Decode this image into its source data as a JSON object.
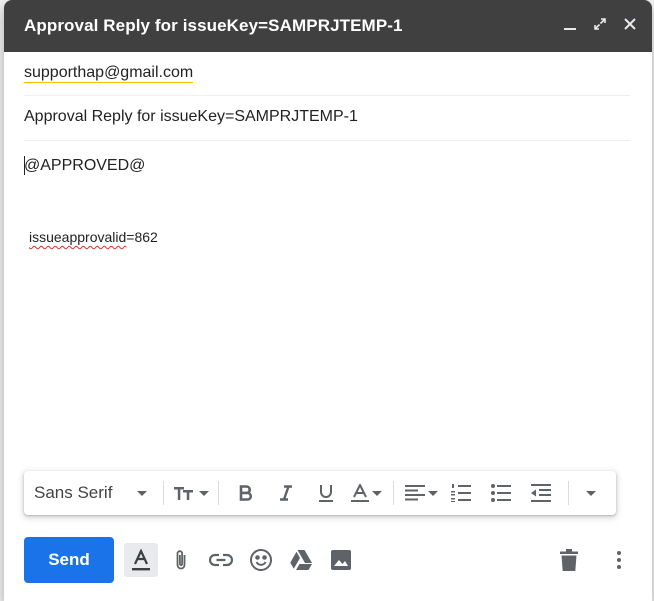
{
  "window": {
    "title": "Approval Reply for issueKey=SAMPRJTEMP-1"
  },
  "recipients": {
    "to": "supporthap@gmail.com"
  },
  "subject": {
    "value": "Approval Reply for issueKey=SAMPRJTEMP-1"
  },
  "body": {
    "line1": "@APPROVED@",
    "line2_key": "issueapprovalid",
    "line2_rest": "=862"
  },
  "format_bar": {
    "font": "Sans Serif"
  },
  "actions": {
    "send_label": "Send"
  },
  "colors": {
    "send": "#1a73e8",
    "titlebar": "#404040"
  }
}
